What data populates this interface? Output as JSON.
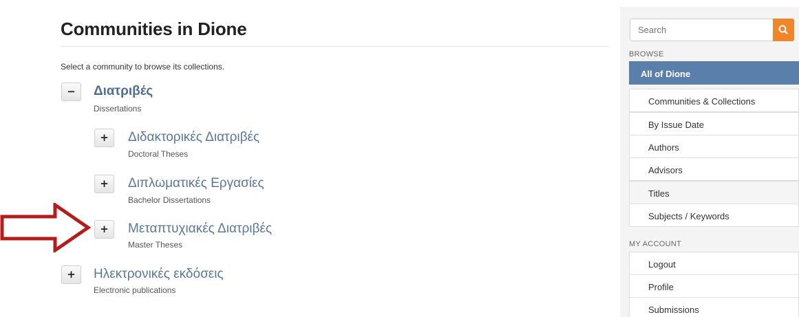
{
  "main": {
    "title": "Communities in Dione",
    "intro": "Select a community to browse its collections.",
    "tree": [
      {
        "toggle": "−",
        "name": "Διατριβές",
        "subtitle": "Dissertations"
      },
      {
        "toggle": "+",
        "name": "Διδακτορικές Διατριβές",
        "subtitle": "Doctoral Theses"
      },
      {
        "toggle": "+",
        "name": "Διπλωματικές Εργασίες",
        "subtitle": "Bachelor Dissertations"
      },
      {
        "toggle": "+",
        "name": "Μεταπτυχιακές Διατριβές",
        "subtitle": "Master Theses"
      },
      {
        "toggle": "+",
        "name": "Ηλεκτρονικές εκδόσεις",
        "subtitle": "Electronic publications"
      }
    ]
  },
  "annotation": {
    "color": "#b51c1c"
  },
  "sidebar": {
    "search": {
      "placeholder": "Search",
      "button_icon": "search-icon",
      "button_color": "#f0862a"
    },
    "browse": {
      "label": "BROWSE",
      "items": [
        {
          "label": "All of Dione"
        },
        {
          "label": "Communities & Collections"
        },
        {
          "label": "By Issue Date"
        },
        {
          "label": "Authors"
        },
        {
          "label": "Advisors"
        },
        {
          "label": "Titles"
        },
        {
          "label": "Subjects / Keywords"
        }
      ]
    },
    "account": {
      "label": "MY ACCOUNT",
      "items": [
        {
          "label": "Logout"
        },
        {
          "label": "Profile"
        },
        {
          "label": "Submissions"
        }
      ]
    },
    "accent": "#5b7fab"
  }
}
